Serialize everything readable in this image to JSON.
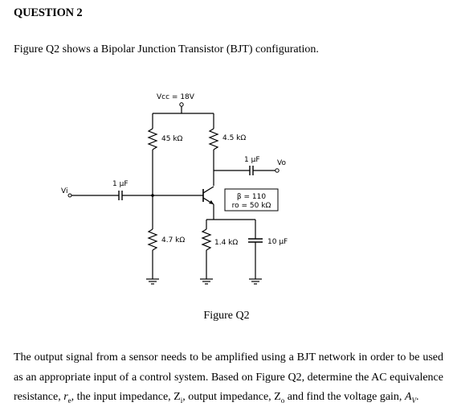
{
  "question": {
    "title": "QUESTION 2",
    "intro": "Figure Q2 shows a Bipolar Junction Transistor (BJT) configuration.",
    "figure_caption": "Figure Q2",
    "body_parts": {
      "p1": "The output signal from a sensor needs to be amplified using a BJT network in order to be used as an appropriate input of a control system.  Based on Figure Q2, determine the AC equivalence resistance, ",
      "re_symbol": "r",
      "re_sub": "e",
      "p2": ", the input impedance, ",
      "zi_symbol": "Z",
      "zi_sub": "i",
      "p3": ", output impedance, ",
      "zo_symbol": "Z",
      "zo_sub": "o",
      "p4": " and find the voltage gain, ",
      "av_symbol": "A",
      "av_sub": "V",
      "p5": "."
    }
  },
  "circuit": {
    "supply_label": "Vcc = 18V",
    "input_label": "Vi",
    "output_label": "Vo",
    "input_cap": "1 µF",
    "output_cap": "1 µF",
    "r1": "45 kΩ",
    "rc": "4.5 kΩ",
    "r2": "4.7 kΩ",
    "re": "1.4 kΩ",
    "ce": "10 µF",
    "params": {
      "beta": "β = 110",
      "ro": "ro = 50 kΩ"
    }
  }
}
